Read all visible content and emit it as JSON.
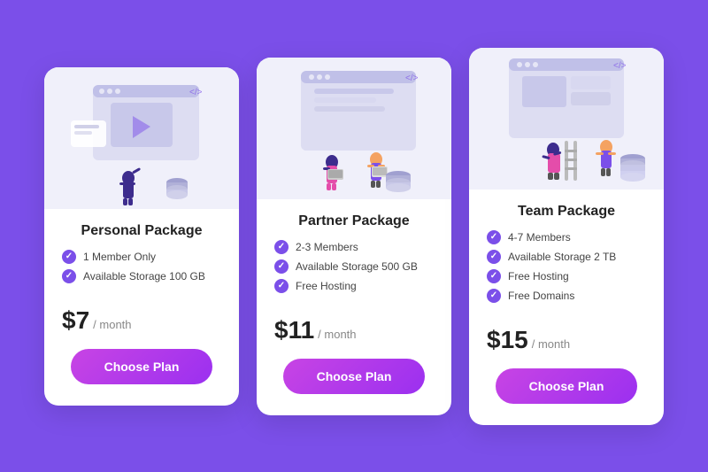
{
  "background_color": "#7B4FE9",
  "cards": [
    {
      "id": "personal",
      "title": "Personal Package",
      "features": [
        "1 Member Only",
        "Available Storage 100 GB"
      ],
      "price": "$7",
      "period": "/ month",
      "button_label": "Choose Plan"
    },
    {
      "id": "partner",
      "title": "Partner Package",
      "features": [
        "2-3 Members",
        "Available Storage 500 GB",
        "Free Hosting"
      ],
      "price": "$11",
      "period": "/ month",
      "button_label": "Choose Plan"
    },
    {
      "id": "team",
      "title": "Team Package",
      "features": [
        "4-7 Members",
        "Available Storage 2 TB",
        "Free Hosting",
        "Free Domains"
      ],
      "price": "$15",
      "period": "/ month",
      "button_label": "Choose Plan"
    }
  ]
}
